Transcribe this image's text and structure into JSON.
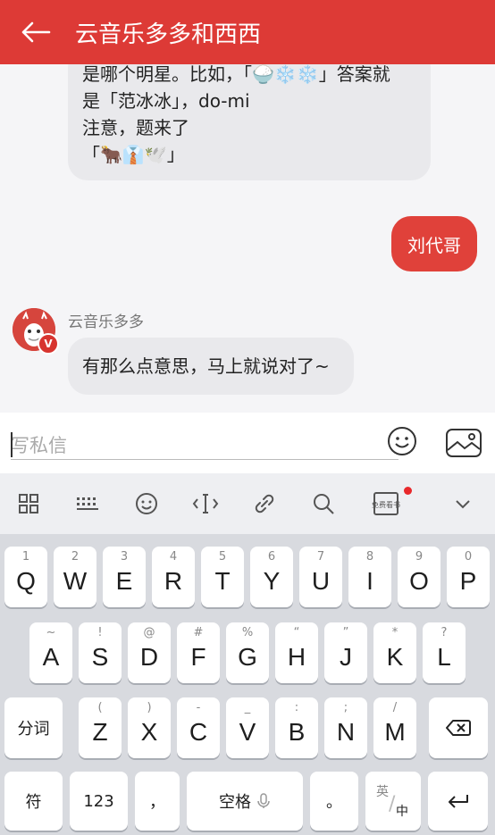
{
  "header": {
    "title": "云音乐多多和西西"
  },
  "chat": {
    "first_bubble_lines": [
      "是哪个明星。比如，「🍚❄️❄️」答案就",
      "是「范冰冰」，do-mi",
      "注意，题来了",
      "「🐂👔🕊️」"
    ],
    "my_message": "刘代哥",
    "sender_name": "云音乐多多",
    "reply": "有那么点意思，马上就说对了~",
    "avatar_badge": "V"
  },
  "input": {
    "placeholder": "写私信"
  },
  "toolbar": {
    "free_book_label": "免费看书"
  },
  "keyboard": {
    "row1": [
      {
        "k": "Q",
        "h": "1"
      },
      {
        "k": "W",
        "h": "2"
      },
      {
        "k": "E",
        "h": "3"
      },
      {
        "k": "R",
        "h": "4"
      },
      {
        "k": "T",
        "h": "5"
      },
      {
        "k": "Y",
        "h": "6"
      },
      {
        "k": "U",
        "h": "7"
      },
      {
        "k": "I",
        "h": "8"
      },
      {
        "k": "O",
        "h": "9"
      },
      {
        "k": "P",
        "h": "0"
      }
    ],
    "row2": [
      {
        "k": "A",
        "h": "~"
      },
      {
        "k": "S",
        "h": "!"
      },
      {
        "k": "D",
        "h": "@"
      },
      {
        "k": "F",
        "h": "#"
      },
      {
        "k": "G",
        "h": "%"
      },
      {
        "k": "H",
        "h": "“"
      },
      {
        "k": "J",
        "h": "”"
      },
      {
        "k": "K",
        "h": "*"
      },
      {
        "k": "L",
        "h": "?"
      }
    ],
    "row3": [
      {
        "k": "Z",
        "h": "("
      },
      {
        "k": "X",
        "h": ")"
      },
      {
        "k": "C",
        "h": "-"
      },
      {
        "k": "V",
        "h": "_"
      },
      {
        "k": "B",
        "h": ":"
      },
      {
        "k": "N",
        "h": ";"
      },
      {
        "k": "M",
        "h": "/"
      }
    ],
    "segment_label": "分词",
    "symbol_label": "符",
    "num_label": "123",
    "comma_label": "，",
    "space_label": "空格",
    "period_label": "。",
    "lang_top": "英",
    "lang_bottom": "中"
  }
}
